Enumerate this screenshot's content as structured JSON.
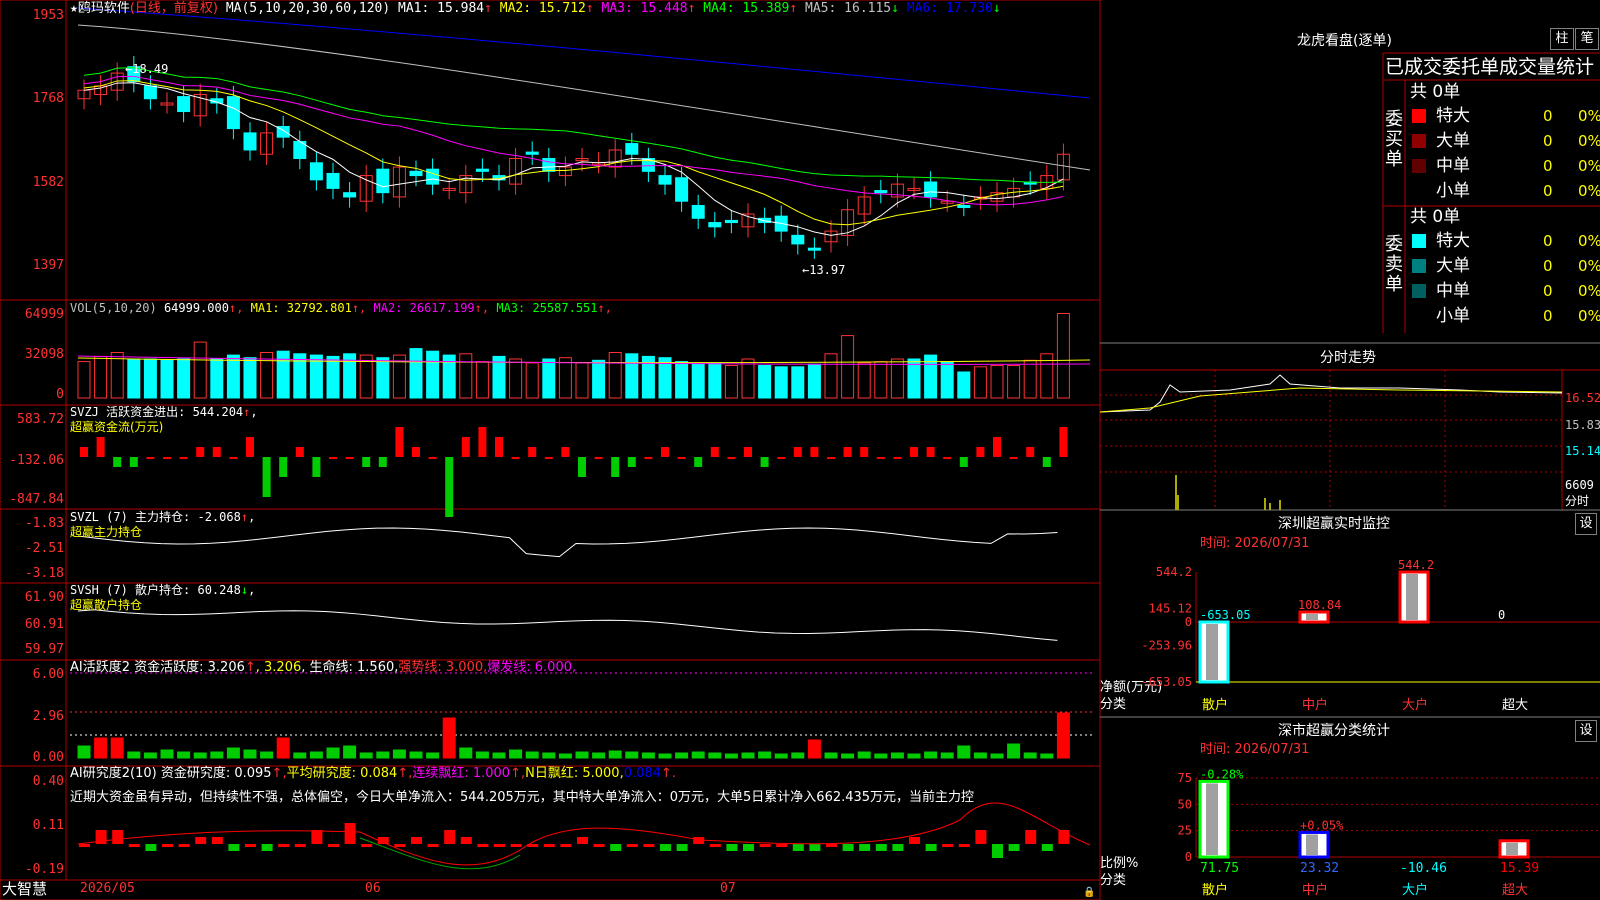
{
  "stock": {
    "star": "★",
    "name": "鸥玛软件",
    "mode": "(日线，前复权)"
  },
  "colors": {
    "up": "#ff3232",
    "down": "#00ffff",
    "frame": "#b00000",
    "ma1": "#ffffff",
    "ma2": "#ffff00",
    "ma3": "#ff00ff",
    "ma4": "#00ff00",
    "ma5": "#c0c0c0",
    "ma6": "#0000ff"
  },
  "main_panel": {
    "ma_header": "MA(5,10,20,30,60,120)",
    "ma": [
      {
        "label": "MA1: 15.984",
        "arrow": "↑",
        "color": "#ffffff"
      },
      {
        "label": "MA2: 15.712",
        "arrow": "↑",
        "color": "#ffff00"
      },
      {
        "label": "MA3: 15.448",
        "arrow": "↑",
        "color": "#ff00ff"
      },
      {
        "label": "MA4: 15.389",
        "arrow": "↑",
        "color": "#00ff00"
      },
      {
        "label": "MA5: 16.115",
        "arrow": "↓",
        "color": "#c0c0c0"
      },
      {
        "label": "MA6: 17.730",
        "arrow": "↓",
        "color": "#0000ff"
      }
    ],
    "y_ticks": [
      "1953",
      "1768",
      "1582",
      "1397"
    ],
    "high_label": "←18.49",
    "low_label": "←13.97"
  },
  "vol_panel": {
    "header": "VOL(5,10,20)",
    "value": "64999.000",
    "ma": [
      {
        "label": "MA1: 32792.801",
        "color": "#ffff00"
      },
      {
        "label": "MA2: 26617.199",
        "color": "#ff00ff"
      },
      {
        "label": "MA3: 25587.551",
        "color": "#00ff00"
      }
    ],
    "y_ticks": [
      "64999",
      "32098",
      "0"
    ]
  },
  "svzj_panel": {
    "line1": "SVZJ  活跃资金进出: 544.204",
    "arrow": "↑",
    "line2": "超赢资金流(万元)",
    "y_ticks": [
      "583.72",
      "-132.06",
      "-847.84"
    ]
  },
  "svzl_panel": {
    "line1": "SVZL (7) 主力持仓: -2.068",
    "arrow": "↑",
    "line2": "超赢主力持仓",
    "y_ticks": [
      "-1.83",
      "-2.51",
      "-3.18"
    ]
  },
  "svsh_panel": {
    "line1": "SVSH (7) 散户持仓: 60.248",
    "arrow": "↓",
    "line2": "超赢散户持仓",
    "y_ticks": [
      "61.90",
      "60.91",
      "59.97"
    ]
  },
  "ai1_panel": {
    "parts": [
      {
        "text": "AI活跃度2 资金活跃度: 3.206",
        "color": "#ffffff"
      },
      {
        "text": "↑",
        "color": "#ff3232"
      },
      {
        "text": ", 3.206",
        "color": "#ffff00"
      },
      {
        "text": ", 生命线: 1.560,",
        "color": "#ffffff"
      },
      {
        "text": "强势线: 3.000,",
        "color": "#ff3232"
      },
      {
        "text": "爆发线: 6.000,",
        "color": "#ff00ff"
      }
    ],
    "y_ticks": [
      "6.00",
      "2.96",
      "0.00"
    ]
  },
  "ai2_panel": {
    "parts": [
      {
        "text": "AI研究度2(10) 资金研究度: 0.095",
        "color": "#ffffff"
      },
      {
        "text": "↑,",
        "color": "#ff3232"
      },
      {
        "text": "平均研究度: 0.084",
        "color": "#ffff00"
      },
      {
        "text": "↑,",
        "color": "#ff3232"
      },
      {
        "text": "连续飘红: 1.000",
        "color": "#ff00ff"
      },
      {
        "text": "↑,",
        "color": "#ff3232"
      },
      {
        "text": "N日飘红: 5.000,",
        "color": "#ffff00"
      },
      {
        "text": "0.084",
        "color": "#0000ff"
      },
      {
        "text": "↑.",
        "color": "#ff3232"
      }
    ],
    "commentary": "近期大资金虽有异动，但持续性不强，总体偏空，今日大单净流入：544.205万元，其中特大单净流入：0万元，大单5日累计净入662.435万元，当前主力控",
    "y_ticks": [
      "0.40",
      "0.11",
      "-0.19"
    ]
  },
  "dates": [
    "2026/05",
    "06",
    "07"
  ],
  "brand": "大智慧",
  "right": {
    "title": "龙虎看盘(逐单)",
    "tabs": [
      "柱",
      "笔"
    ],
    "stats_title": "已成交委托单成交量统计",
    "buy": {
      "side": "委买单",
      "total": "共 0单",
      "rows": [
        {
          "label": "特大",
          "value": "0",
          "pct": "0%",
          "color": "#ff0000"
        },
        {
          "label": "大单",
          "value": "0",
          "pct": "0%",
          "color": "#900000"
        },
        {
          "label": "中单",
          "value": "0",
          "pct": "0%",
          "color": "#600000"
        },
        {
          "label": "小单",
          "value": "0",
          "pct": "0%",
          "color": "#000000"
        }
      ]
    },
    "sell": {
      "side": "委卖单",
      "total": "共 0单",
      "rows": [
        {
          "label": "特大",
          "value": "0",
          "pct": "0%",
          "color": "#00ffff"
        },
        {
          "label": "大单",
          "value": "0",
          "pct": "0%",
          "color": "#008080"
        },
        {
          "label": "中单",
          "value": "0",
          "pct": "0%",
          "color": "#006060"
        },
        {
          "label": "小单",
          "value": "0",
          "pct": "0%",
          "color": "#000000"
        }
      ]
    },
    "intraday": {
      "title": "分时走势",
      "y_ticks": [
        "16.52",
        "15.83",
        "15.14"
      ],
      "vol_label": "6609",
      "vol_unit": "分时"
    },
    "sz_monitor": {
      "title": "深圳超赢实时监控",
      "setting": "设",
      "date": "时间: 2026/07/31",
      "ylabel": "净额(万元)",
      "xlabel": "分类",
      "y_ticks": [
        "544.2",
        "145.12",
        "0",
        "-253.96",
        "-653.05"
      ]
    },
    "sz_class": {
      "title": "深市超赢分类统计",
      "setting": "设",
      "date": "时间: 2026/07/31",
      "ylabel": "比例%",
      "xlabel": "分类",
      "y_ticks": [
        "75",
        "50",
        "25",
        "0"
      ]
    }
  },
  "chart_data": [
    {
      "type": "candlestick",
      "title": "鸥玛软件(日线，前复权)",
      "y_range_label": [
        "13.97",
        "18.49"
      ],
      "price_high": "18.49",
      "price_low": "13.97",
      "ma_last": [
        15.984,
        15.712,
        15.448,
        15.389,
        16.115,
        17.73
      ]
    },
    {
      "type": "bar",
      "title": "深圳超赢实时监控",
      "categories": [
        "散户",
        "中户",
        "大户",
        "超大"
      ],
      "values": [
        -653.05,
        108.84,
        544.2,
        0
      ],
      "value_labels": [
        "-653.05",
        "108.84",
        "544.2",
        "0"
      ],
      "ylim": [
        -653.05,
        544.2
      ],
      "ylabel": "净额(万元)",
      "xlabel": "分类"
    },
    {
      "type": "bar",
      "title": "深市超赢分类统计",
      "categories": [
        "散户",
        "中户",
        "大户",
        "超大"
      ],
      "values": [
        71.75,
        23.32,
        -10.46,
        15.39
      ],
      "value_labels": [
        "71.75",
        "23.32",
        "-10.46",
        "15.39"
      ],
      "change_labels": [
        "-0.28%",
        "+0.05%",
        "",
        ""
      ],
      "ylim": [
        0,
        75
      ],
      "ylabel": "比例%",
      "xlabel": "分类"
    }
  ]
}
